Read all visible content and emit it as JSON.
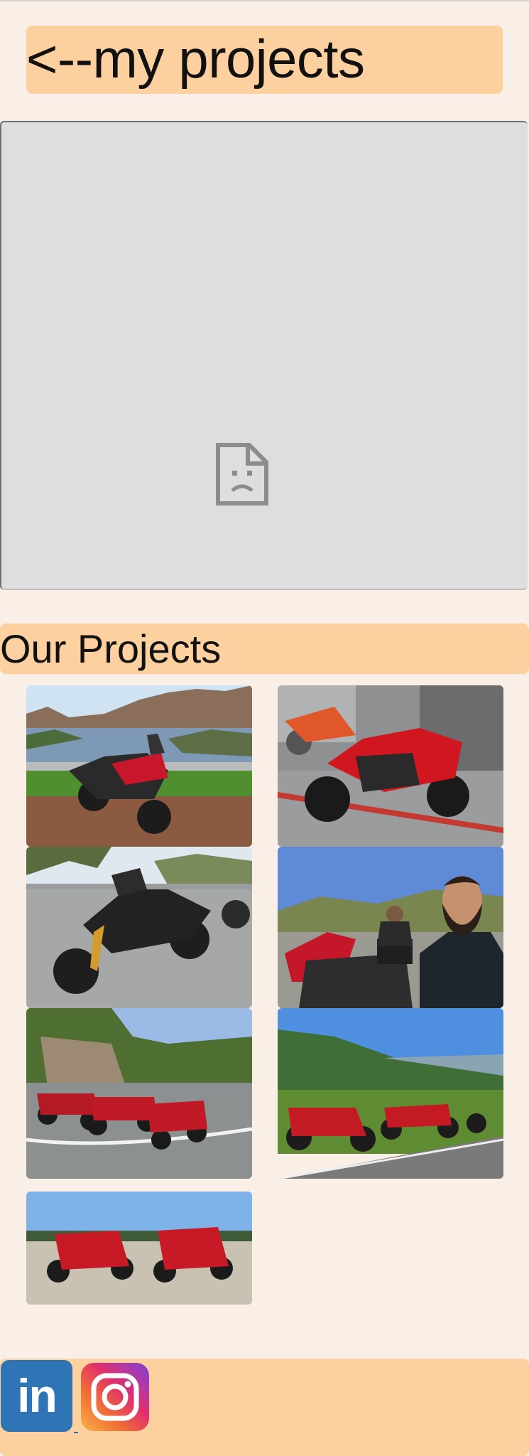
{
  "header": {
    "back_link_label": "<--my projects"
  },
  "embed": {
    "state": "unavailable",
    "icon": "broken-document-icon"
  },
  "projects": {
    "title": "Our Projects",
    "photos": [
      {
        "name": "photo-bmw-lake"
      },
      {
        "name": "photo-red-ducati-monster"
      },
      {
        "name": "photo-black-roadster"
      },
      {
        "name": "photo-rider-selfie"
      },
      {
        "name": "photo-bikes-on-curve"
      },
      {
        "name": "photo-bikes-in-valley"
      },
      {
        "name": "photo-two-red-bikes"
      }
    ]
  },
  "footer": {
    "social_links": [
      {
        "name": "LinkedIn",
        "label": "in",
        "icon": "linkedin-icon",
        "color": "#2f74b4"
      },
      {
        "name": "Instagram",
        "icon": "instagram-icon"
      }
    ]
  },
  "colors": {
    "background": "#f9efe7",
    "accent": "#fdd19f",
    "embed_bg": "#dedede"
  }
}
